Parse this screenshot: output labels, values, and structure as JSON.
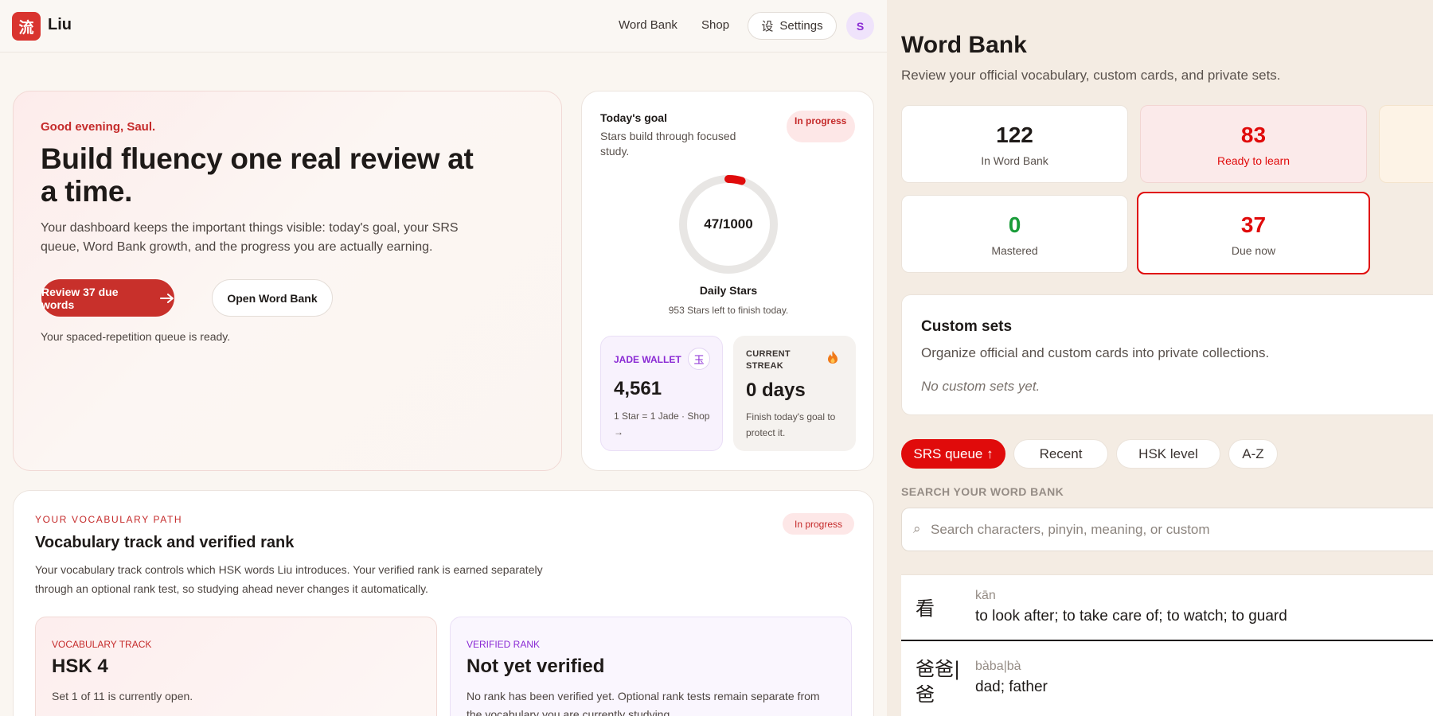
{
  "header": {
    "logo_char": "流",
    "brand": "Liu",
    "nav": [
      "Word Bank",
      "Shop"
    ],
    "settings_label": "Settings",
    "settings_icon": "设",
    "avatar_initial": "S"
  },
  "hero": {
    "greeting": "Good evening, Saul.",
    "title": "Build fluency one real review at a time.",
    "description": "Your dashboard keeps the important things visible: today's goal, your SRS queue, Word Bank growth, and the progress you are actually earning.",
    "primary_button": "Review 37 due words",
    "secondary_button": "Open Word Bank",
    "footnote": "Your spaced-repetition queue is ready."
  },
  "goal": {
    "title": "Today's goal",
    "subtitle": "Stars build through focused study.",
    "status": "In progress",
    "current": 47,
    "target": 1000,
    "ring_label": "47/1000",
    "ring_label_name": "Daily Stars",
    "remaining": "953 Stars left to finish today.",
    "colors": {
      "ring_fill": "#e00b0b",
      "ring_track": "#e8e6e4"
    }
  },
  "wallet": {
    "label": "JADE WALLET",
    "badge_char": "玉",
    "value": "4,561",
    "note": "1 Star = 1 Jade · Shop →"
  },
  "streak": {
    "label": "CURRENT STREAK",
    "icon": "flame-icon",
    "value": "0 days",
    "note": "Finish today's goal to protect it."
  },
  "vocab_path": {
    "eyebrow": "YOUR VOCABULARY PATH",
    "title": "Vocabulary track and verified rank",
    "description": "Your vocabulary track controls which HSK words Liu introduces. Your verified rank is earned separately through an optional rank test, so studying ahead never changes it automatically.",
    "status": "In progress",
    "track": {
      "eyebrow": "VOCABULARY TRACK",
      "value": "HSK 4",
      "note": "Set 1 of 11 is currently open."
    },
    "rank": {
      "eyebrow": "VERIFIED RANK",
      "value": "Not yet verified",
      "note": "No rank has been verified yet. Optional rank tests remain separate from the vocabulary you are currently studying."
    }
  },
  "word_bank": {
    "title": "Word Bank",
    "subtitle": "Review your official vocabulary, custom cards, and private sets.",
    "stats": [
      {
        "value": "122",
        "label": "In Word Bank",
        "color": "#1e1a18"
      },
      {
        "value": "83",
        "label": "Ready to learn",
        "color": "#e00b0b"
      },
      {
        "value": "0",
        "label": "Mastered",
        "color": "#1a9c3a"
      },
      {
        "value": "37",
        "label": "Due now",
        "color": "#e00b0b"
      }
    ],
    "sets": {
      "title": "Custom sets",
      "description": "Organize official and custom cards into private collections.",
      "empty": "No custom sets yet."
    },
    "sort_options": [
      "SRS queue ↑",
      "Recent",
      "HSK level",
      "A-Z"
    ],
    "search": {
      "label": "SEARCH YOUR WORD BANK",
      "placeholder": "Search characters, pinyin, meaning, or custom"
    },
    "words": [
      {
        "hanzi": "看",
        "pinyin": "kān",
        "meaning": "to look after; to take care of; to watch; to guard"
      },
      {
        "hanzi": "爸爸|爸",
        "pinyin": "bàba|bà",
        "meaning": "dad; father"
      }
    ]
  }
}
